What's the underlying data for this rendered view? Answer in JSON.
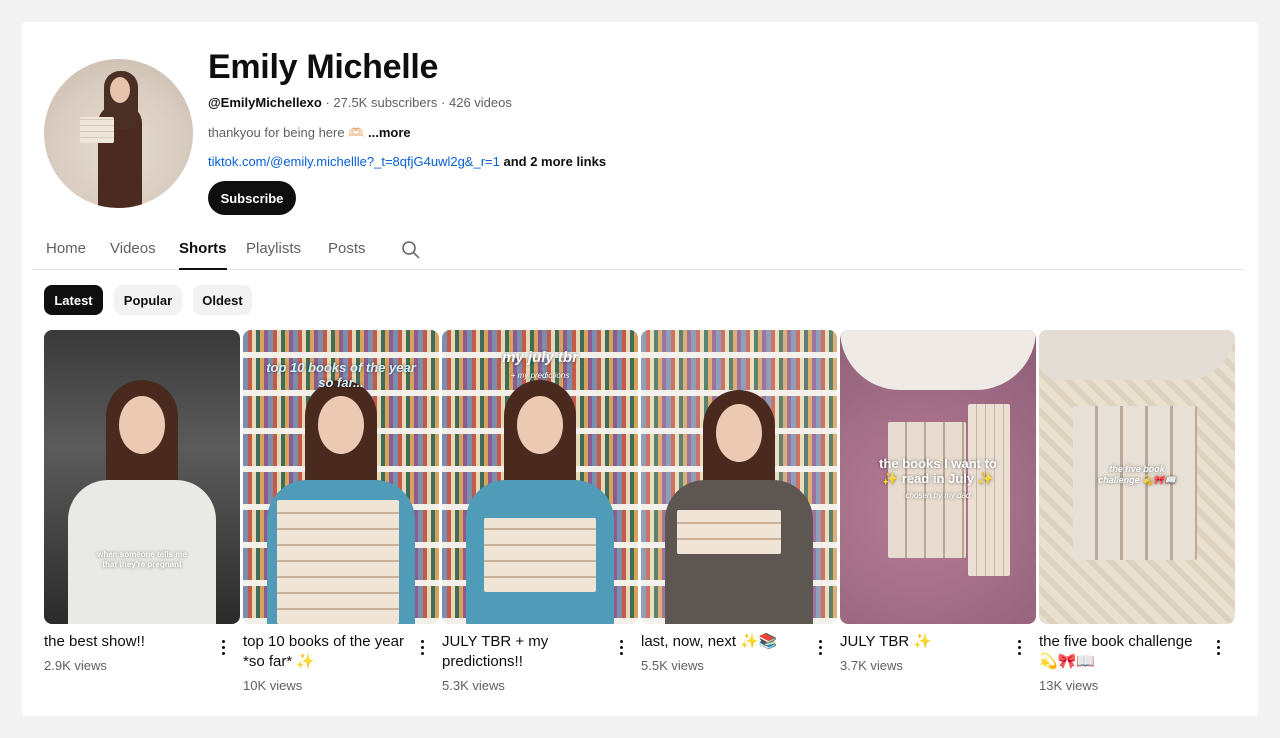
{
  "channel": {
    "name": "Emily Michelle",
    "handle": "@EmilyMichellexo",
    "stats": " · 27.5K subscribers · 426 videos",
    "description": "thankyou for being here 🫶🏻 ",
    "more_label": "...more",
    "link_url": "tiktok.com/@emily.michellle?_t=8qfjG4uwl2g&_r=1",
    "more_links": " and 2 more links",
    "subscribe_label": "Subscribe"
  },
  "tabs": [
    {
      "label": "Home",
      "active": false
    },
    {
      "label": "Videos",
      "active": false
    },
    {
      "label": "Shorts",
      "active": true
    },
    {
      "label": "Playlists",
      "active": false
    },
    {
      "label": "Posts",
      "active": false
    }
  ],
  "search_icon": "search-icon",
  "filters": [
    {
      "label": "Latest",
      "active": true
    },
    {
      "label": "Popular",
      "active": false
    },
    {
      "label": "Oldest",
      "active": false
    }
  ],
  "shorts": [
    {
      "title": "the best show!!",
      "views": "2.9K views",
      "overlay": "when someone tells me\nthat they're pregnant",
      "overlay_sub": ""
    },
    {
      "title": "top 10 books of the year *so far* ✨",
      "views": "10K views",
      "overlay": "top 10 books of the year\nso far...",
      "overlay_sub": ""
    },
    {
      "title": "JULY TBR + my predictions!!",
      "views": "5.3K views",
      "overlay": "my july tbr",
      "overlay_sub": "+ my predictions"
    },
    {
      "title": "last, now, next ✨📚",
      "views": "5.5K views",
      "overlay": "",
      "overlay_sub": ""
    },
    {
      "title": "JULY TBR ✨",
      "views": "3.7K views",
      "overlay": "the books I want to\n✨ read in July ✨",
      "overlay_sub": "chosen by my dad"
    },
    {
      "title": "the five book challenge 💫🎀📖",
      "views": "13K views",
      "overlay": "the five book\nchallenge 💫🎀📖",
      "overlay_sub": ""
    }
  ],
  "colors": {
    "link": "#065fd4",
    "primary": "#0f0f0f",
    "secondary": "#606060"
  }
}
